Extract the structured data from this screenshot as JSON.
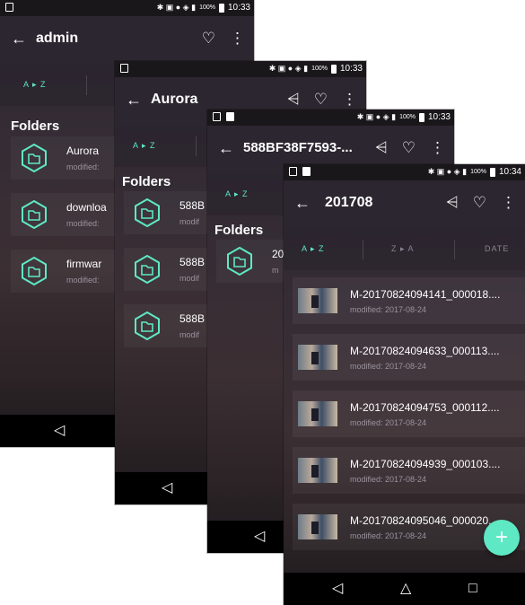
{
  "status": {
    "time": "10:33",
    "time_last": "10:34",
    "battery": "100%"
  },
  "sort": {
    "az": "A ▸ Z",
    "za": "Z ▸ A",
    "date": "DATE"
  },
  "accent_color": "#5ee8c4",
  "screen1": {
    "title": "admin",
    "section": "Folders",
    "folders": [
      {
        "name": "Aurora",
        "modified": "modified:"
      },
      {
        "name": "downloa",
        "modified": "modified:"
      },
      {
        "name": "firmwar",
        "modified": "modified:"
      }
    ]
  },
  "screen2": {
    "title": "Aurora",
    "section": "Folders",
    "folders": [
      {
        "name": "588B",
        "modified": "modif"
      },
      {
        "name": "588B",
        "modified": "modif"
      },
      {
        "name": "588B",
        "modified": "modif"
      }
    ]
  },
  "screen3": {
    "title": "588BF38F7593-...",
    "section": "Folders",
    "folders": [
      {
        "name": "20",
        "modified": "m"
      }
    ]
  },
  "screen4": {
    "title": "201708",
    "videos": [
      {
        "name": "M-20170824094141_000018....",
        "modified": "modified: 2017-08-24"
      },
      {
        "name": "M-20170824094633_000113....",
        "modified": "modified: 2017-08-24"
      },
      {
        "name": "M-20170824094753_000112....",
        "modified": "modified: 2017-08-24"
      },
      {
        "name": "M-20170824094939_000103....",
        "modified": "modified: 2017-08-24"
      },
      {
        "name": "M-20170824095046_000020...",
        "modified": "modified: 2017-08-24"
      }
    ],
    "fab": "+"
  },
  "icons": {
    "back": "←",
    "share": "share-icon",
    "favorite": "heart-icon",
    "more": "more-vert-icon",
    "nav_back": "◁",
    "nav_home": "△",
    "nav_recent": "□"
  }
}
